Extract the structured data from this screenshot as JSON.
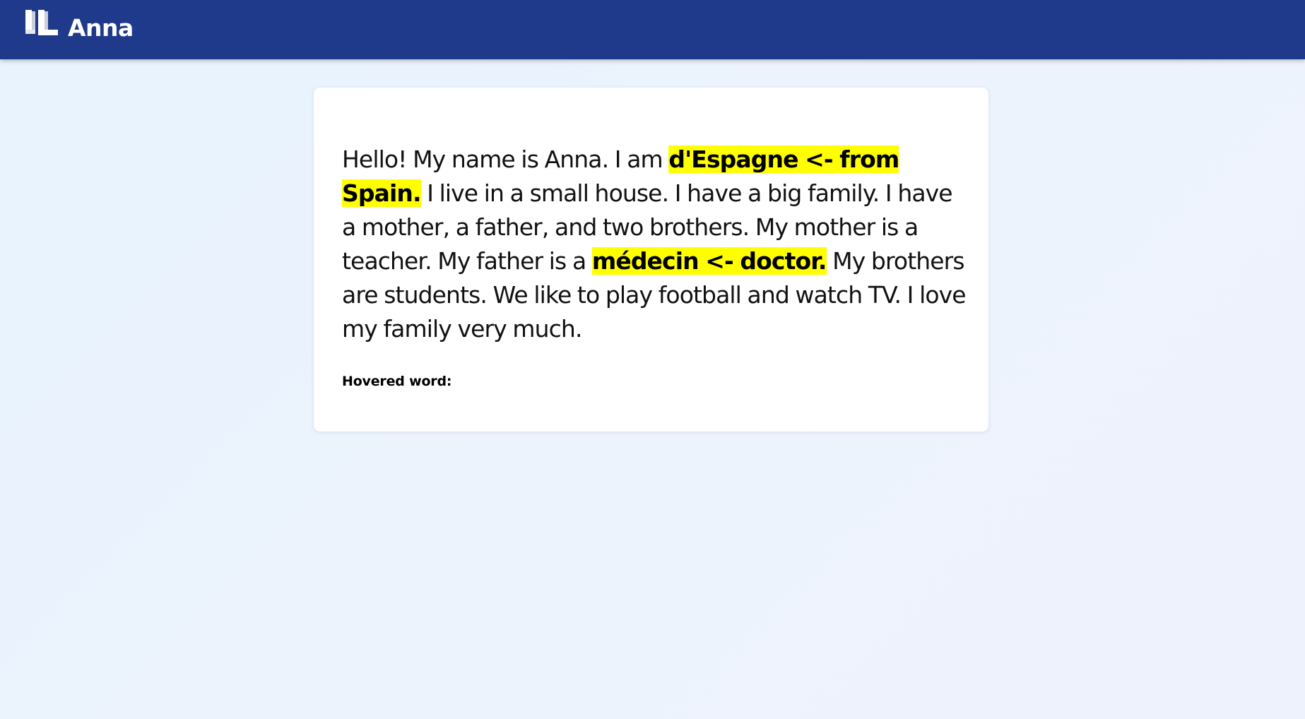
{
  "header": {
    "title": "Anna",
    "logo_icon": "book-logo-icon",
    "background_color": "#1f3a8a"
  },
  "story": {
    "segments": [
      {
        "text": "Hello! My name is Anna. I am ",
        "highlight": false
      },
      {
        "text": "d'Espagne <- from Spain.",
        "highlight": true
      },
      {
        "text": " I live in a small house. I have a big family. I have a mother, a father, and two brothers. My mother is a teacher. My father is a ",
        "highlight": false
      },
      {
        "text": "médecin <- doctor.",
        "highlight": true
      },
      {
        "text": " My brothers are students. We like to play football and watch TV. I love my family very much.",
        "highlight": false
      }
    ],
    "highlight_color": "#ffff00"
  },
  "hover": {
    "label": "Hovered word:",
    "value": ""
  }
}
